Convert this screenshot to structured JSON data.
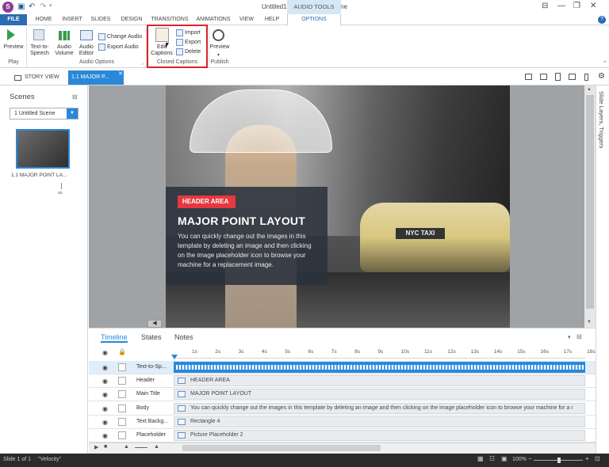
{
  "window": {
    "title": "Untitled1* - Articulate Storyline",
    "logo": "S",
    "context_tab_group": "AUDIO TOOLS"
  },
  "quick_access": {
    "save_icon": "save-icon",
    "undo_icon": "undo-icon",
    "redo_icon": "redo-icon"
  },
  "ribbon_tabs": {
    "file": "FILE",
    "home": "HOME",
    "insert": "INSERT",
    "slides": "SLIDES",
    "design": "DESIGN",
    "transitions": "TRANSITIONS",
    "animations": "ANIMATIONS",
    "view": "VIEW",
    "help": "HELP",
    "options": "OPTIONS"
  },
  "ribbon": {
    "preview": "Preview",
    "play_group": "Play",
    "text_to_speech": "Text-to-\nSpeech",
    "audio_volume": "Audio\nVolume",
    "audio_editor": "Audio\nEditor",
    "change_audio": "Change Audio",
    "export_audio": "Export Audio",
    "audio_options_group": "Audio Options",
    "edit_captions": "Edit\nCaptions",
    "import": "Import",
    "export": "Export",
    "delete": "Delete",
    "closed_captions_group": "Closed Captions",
    "preview2": "Preview",
    "publish_group": "Publish"
  },
  "doc_tabs": {
    "story_view": "STORY VIEW",
    "slide": "1.1 MAJOR P..."
  },
  "scenes": {
    "title": "Scenes",
    "selected_scene": "1 Untitled Scene",
    "thumb_label": "1.1 MAJOR POINT LA..."
  },
  "slide": {
    "header_area": "HEADER AREA",
    "main_title": "MAJOR POINT LAYOUT",
    "body": "You can quickly change out the images in this template by deleting an image and then clicking on the image placeholder icon to browse your machine for a replacement image.",
    "taxi_sign": "NYC TAXI"
  },
  "right_panel": {
    "label": "Slide Layers, Triggers"
  },
  "timeline": {
    "tabs": [
      "Timeline",
      "States",
      "Notes"
    ],
    "ticks": [
      "1s",
      "2s",
      "3s",
      "4s",
      "5s",
      "6s",
      "7s",
      "8s",
      "9s",
      "10s",
      "11s",
      "12s",
      "13s",
      "14s",
      "15s",
      "16s",
      "17s",
      "18s"
    ],
    "rows": [
      {
        "name": "Text-to-Sp...",
        "bar": ""
      },
      {
        "name": "Header",
        "bar": "HEADER AREA"
      },
      {
        "name": "Main Title",
        "bar": "MAJOR POINT LAYOUT"
      },
      {
        "name": "Body",
        "bar": "You can quickly change out the images in this template by deleting an image and then clicking on the image placeholder icon to browse your machine for a r"
      },
      {
        "name": "Text Backg...",
        "bar": "Rectangle 4"
      },
      {
        "name": "Placeholder",
        "bar": "Picture Placeholder 2"
      }
    ]
  },
  "status": {
    "slide_count": "Slide 1 of 1",
    "theme": "\"Velocity\"",
    "zoom": "100%"
  }
}
